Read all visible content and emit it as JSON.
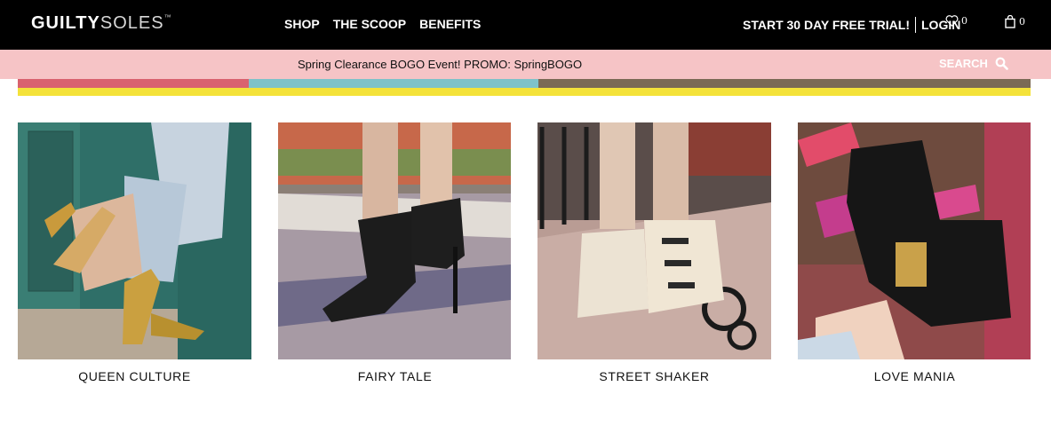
{
  "header": {
    "logo_bold": "GUILTY",
    "logo_light": "SOLES",
    "logo_tm": "™",
    "nav": [
      "SHOP",
      "THE SCOOP",
      "BENEFITS"
    ],
    "trial": "START 30 DAY FREE TRIAL!",
    "login": "LOGIN",
    "wishlist_count": "0",
    "cart_count": "0"
  },
  "promo": {
    "text": "Spring Clearance BOGO Event! PROMO: SpringBOGO",
    "search_label": "SEARCH"
  },
  "colors": {
    "topbar": "#000000",
    "promo": "#f6c4c6",
    "banner_stripe": "#f4e23a"
  },
  "products": [
    {
      "name": "QUEEN CULTURE"
    },
    {
      "name": "FAIRY TALE"
    },
    {
      "name": "STREET SHAKER"
    },
    {
      "name": "LOVE MANIA"
    }
  ]
}
